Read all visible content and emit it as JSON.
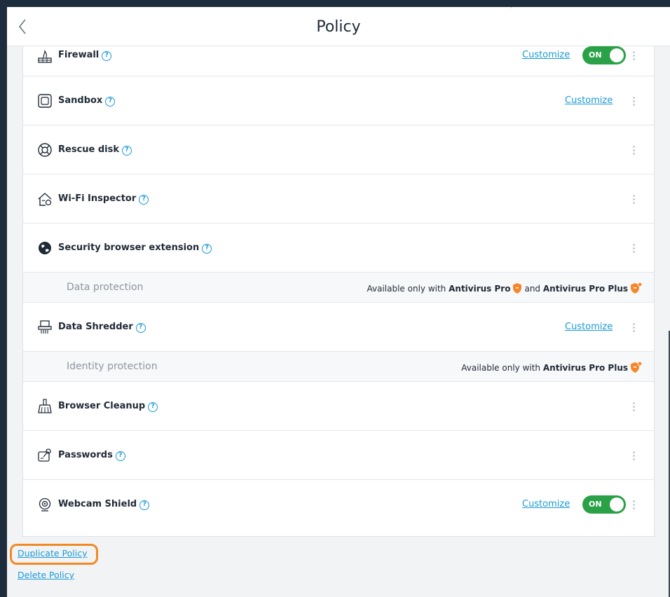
{
  "header": {
    "title": "Policy"
  },
  "rows": [
    {
      "label": "Firewall",
      "customize": "Customize",
      "toggle": "ON"
    },
    {
      "label": "Sandbox",
      "customize": "Customize"
    },
    {
      "label": "Rescue disk"
    },
    {
      "label": "Wi-Fi Inspector"
    },
    {
      "label": "Security browser extension"
    },
    {
      "label": "Data Shredder",
      "customize": "Customize"
    },
    {
      "label": "Browser Cleanup"
    },
    {
      "label": "Passwords"
    },
    {
      "label": "Webcam Shield",
      "customize": "Customize",
      "toggle": "ON"
    }
  ],
  "sections": {
    "data_protection": {
      "label": "Data protection",
      "prefix": "Available only with",
      "product1": "Antivirus Pro",
      "conj": "and",
      "product2": "Antivirus Pro Plus"
    },
    "identity_protection": {
      "label": "Identity protection",
      "prefix": "Available only with",
      "product": "Antivirus Pro Plus"
    }
  },
  "footer": {
    "duplicate": "Duplicate Policy",
    "delete": "Delete Policy"
  },
  "help_glyph": "?",
  "colors": {
    "accent": "#1a9ad6",
    "toggle_on": "#2aa147",
    "highlight": "#f08a24",
    "shield": "#f7862a"
  }
}
